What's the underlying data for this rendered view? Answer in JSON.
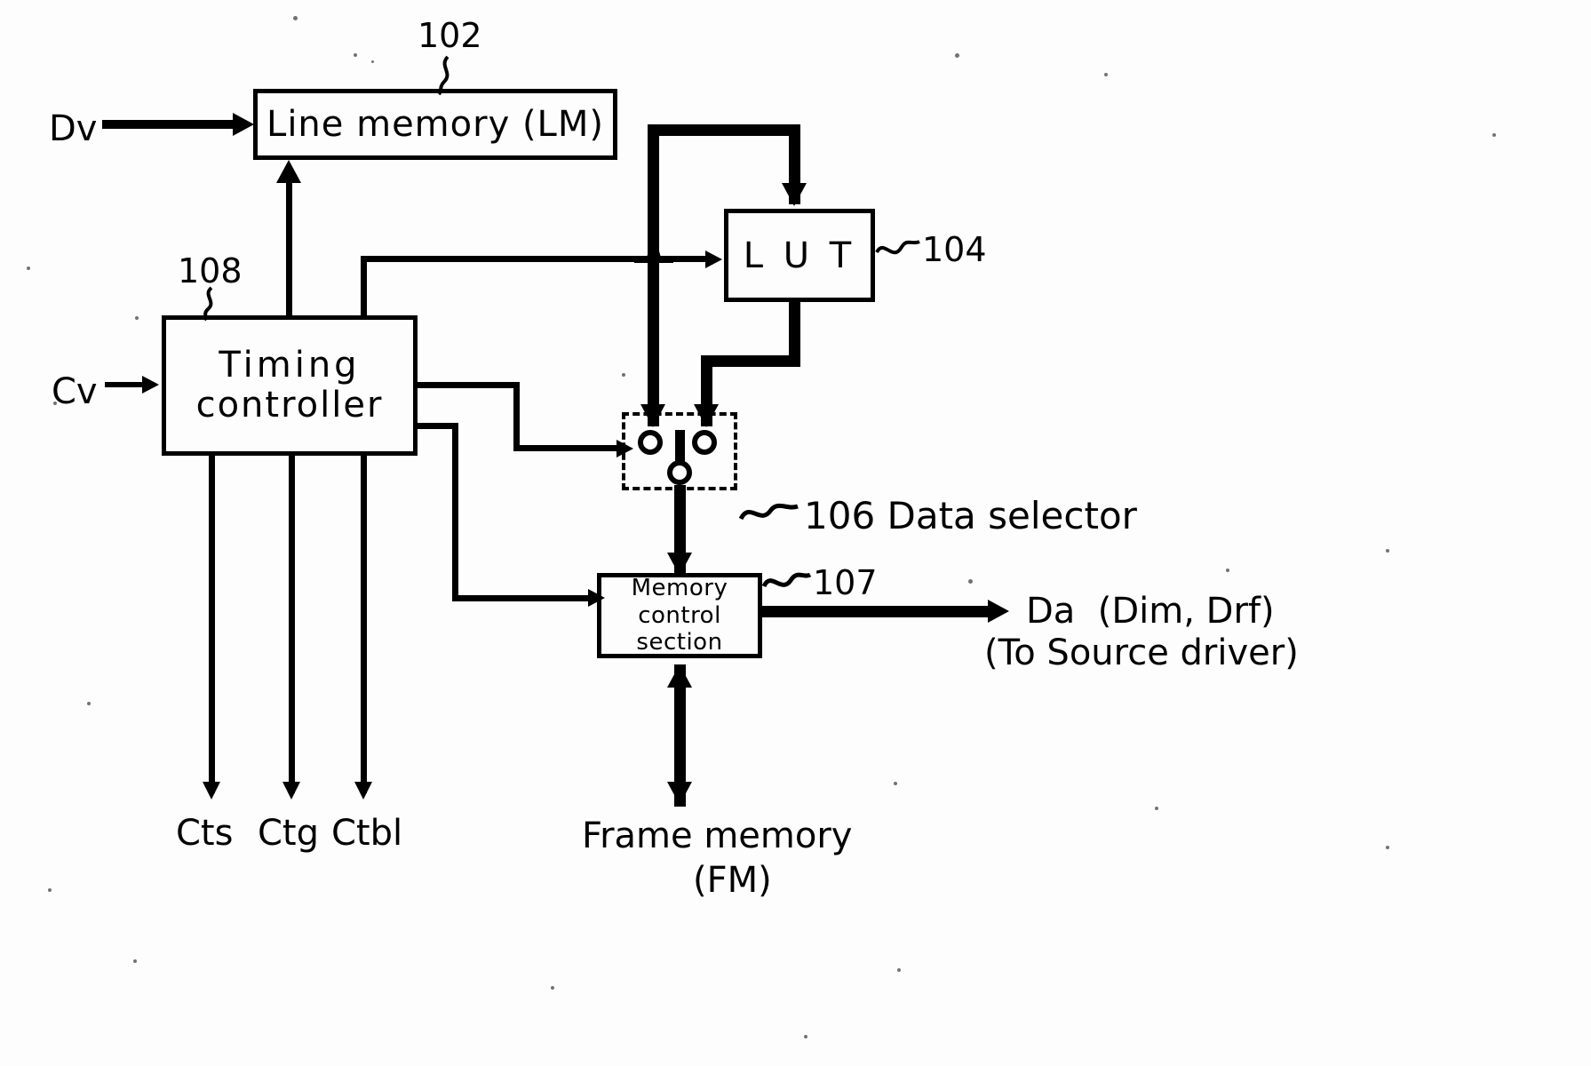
{
  "figure": {
    "type": "block-diagram",
    "blocks": [
      {
        "id": "102",
        "label": "Line  memory  (LM)",
        "ref": "102"
      },
      {
        "id": "104",
        "label": "L U T",
        "ref": "104"
      },
      {
        "id": "106",
        "label": "106 Data selector",
        "ref": "106"
      },
      {
        "id": "107",
        "label_l1": "Memory",
        "label_l2": "control",
        "label_l3": "section",
        "ref": "107"
      },
      {
        "id": "108",
        "label_l1": "Timing",
        "label_l2": "controller",
        "ref": "108"
      }
    ],
    "inputs": [
      {
        "name": "Dv",
        "label": "Dv"
      },
      {
        "name": "Cv",
        "label": "Cv"
      }
    ],
    "outputs": [
      {
        "name": "Cts",
        "label": "Cts"
      },
      {
        "name": "Ctg",
        "label": "Ctg"
      },
      {
        "name": "Ctbl",
        "label": "Ctbl"
      },
      {
        "name": "Da",
        "label_l1": "Da  (Dim, Drf)",
        "label_l2": "(To Source driver)"
      },
      {
        "name": "FM",
        "label_l1": "Frame memory",
        "label_l2": "(FM)"
      }
    ],
    "refs": {
      "line_memory": "102",
      "lut": "104",
      "data_selector": "106 Data selector",
      "memory_control": "107",
      "timing_controller": "108"
    },
    "colors": {
      "ink": "#000000",
      "paper": "#fdfdfd"
    }
  }
}
